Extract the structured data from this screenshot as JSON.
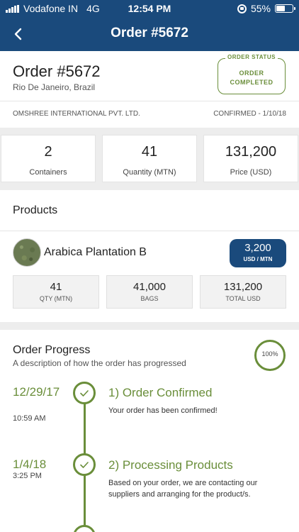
{
  "status_bar": {
    "carrier": "Vodafone IN",
    "network": "4G",
    "time": "12:54 PM",
    "battery": "55%",
    "battery_level": 0.55,
    "icons": [
      "signal-icon",
      "rotation-lock-icon",
      "battery-icon"
    ]
  },
  "nav": {
    "title": "Order #5672",
    "back_icon": "chevron-left-icon"
  },
  "order": {
    "title": "Order #5672",
    "location": "Rio De Janeiro, Brazil",
    "status_label": "ORDER STATUS",
    "status_line1": "ORDER",
    "status_line2": "COMPLETED",
    "company": "OMSHREE INTERNATIONAL PVT. LTD.",
    "confirmed": "CONFIRMED - 1/10/18"
  },
  "stats": [
    {
      "value": "2",
      "label": "Containers"
    },
    {
      "value": "41",
      "label": "Quantity (MTN)"
    },
    {
      "value": "131,200",
      "label": "Price (USD)"
    }
  ],
  "products": {
    "title": "Products",
    "item": {
      "name": "Arabica Plantation B",
      "price": "3,200",
      "price_unit": "USD / MTN",
      "metrics": [
        {
          "value": "41",
          "label": "QTY (MTN)"
        },
        {
          "value": "41,000",
          "label": "BAGS"
        },
        {
          "value": "131,200",
          "label": "TOTAL USD"
        }
      ]
    }
  },
  "progress": {
    "title": "Order Progress",
    "description": "A description of how the order has progressed",
    "percent": "100%",
    "steps": [
      {
        "date": "12/29/17",
        "time": "10:59 AM",
        "title": "1) Order Confirmed",
        "text": "Your order has been confirmed!"
      },
      {
        "date": "1/4/18",
        "time": "3:25 PM",
        "title": "2) Processing Products",
        "text": "Based on your order, we are contacting our suppliers and arranging for the product/s."
      }
    ]
  },
  "colors": {
    "primary": "#1a4a7c",
    "accent_green": "#6a8e3a",
    "background": "#ededed"
  }
}
